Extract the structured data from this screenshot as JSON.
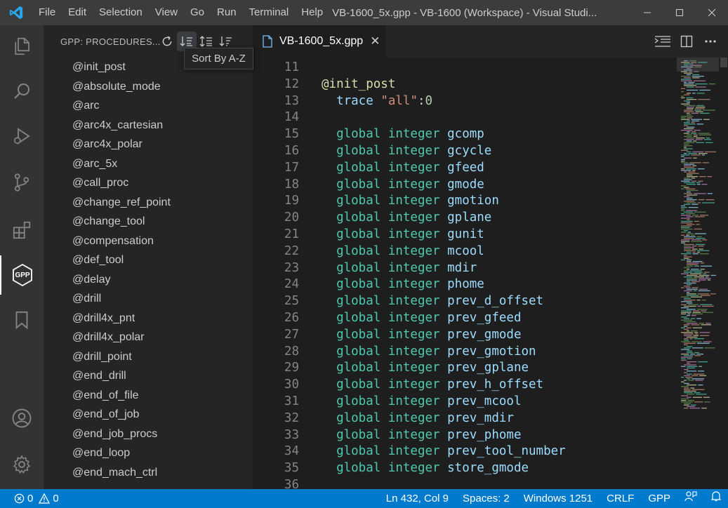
{
  "window": {
    "title": "VB-1600_5x.gpp - VB-1600 (Workspace) - Visual Studi...",
    "menu": [
      "File",
      "Edit",
      "Selection",
      "View",
      "Go",
      "Run",
      "Terminal",
      "Help"
    ]
  },
  "activity_bar": {
    "items": [
      "explorer-icon",
      "search-icon",
      "run-debug-icon",
      "source-control-icon",
      "extensions-icon",
      "gpp-icon",
      "bookmark-icon"
    ],
    "gpp_label": "GPP",
    "bottom": [
      "account-icon",
      "settings-gear-icon"
    ]
  },
  "sidebar": {
    "title": "GPP: PROCEDURES...",
    "actions": [
      "refresh-icon",
      "sort-az-icon",
      "sort-line-icon",
      "sort-desc-icon"
    ],
    "tooltip": "Sort By A-Z",
    "procedures": [
      "@init_post",
      "@absolute_mode",
      "@arc",
      "@arc4x_cartesian",
      "@arc4x_polar",
      "@arc_5x",
      "@call_proc",
      "@change_ref_point",
      "@change_tool",
      "@compensation",
      "@def_tool",
      "@delay",
      "@drill",
      "@drill4x_pnt",
      "@drill4x_polar",
      "@drill_point",
      "@end_drill",
      "@end_of_file",
      "@end_of_job",
      "@end_job_procs",
      "@end_loop",
      "@end_mach_ctrl"
    ]
  },
  "editor": {
    "tab": {
      "label": "VB-1600_5x.gpp",
      "icon": "file-icon"
    },
    "lines": [
      {
        "n": "11",
        "tokens": []
      },
      {
        "n": "12",
        "tokens": [
          [
            "@init_post",
            "at"
          ]
        ]
      },
      {
        "n": "13",
        "tokens": [
          [
            "  ",
            "plain"
          ],
          [
            "trace",
            "blue"
          ],
          [
            " ",
            "plain"
          ],
          [
            "\"all\"",
            "str"
          ],
          [
            ":",
            "plain"
          ],
          [
            "0",
            "num"
          ]
        ]
      },
      {
        "n": "14",
        "tokens": []
      },
      {
        "n": "15",
        "tokens": [
          [
            "  global integer ",
            "teal"
          ],
          [
            "gcomp",
            "blue"
          ]
        ]
      },
      {
        "n": "16",
        "tokens": [
          [
            "  global integer ",
            "teal"
          ],
          [
            "gcycle",
            "blue"
          ]
        ]
      },
      {
        "n": "17",
        "tokens": [
          [
            "  global integer ",
            "teal"
          ],
          [
            "gfeed",
            "blue"
          ]
        ]
      },
      {
        "n": "18",
        "tokens": [
          [
            "  global integer ",
            "teal"
          ],
          [
            "gmode",
            "blue"
          ]
        ]
      },
      {
        "n": "19",
        "tokens": [
          [
            "  global integer ",
            "teal"
          ],
          [
            "gmotion",
            "blue"
          ]
        ]
      },
      {
        "n": "20",
        "tokens": [
          [
            "  global integer ",
            "teal"
          ],
          [
            "gplane",
            "blue"
          ]
        ]
      },
      {
        "n": "21",
        "tokens": [
          [
            "  global integer ",
            "teal"
          ],
          [
            "gunit",
            "blue"
          ]
        ]
      },
      {
        "n": "22",
        "tokens": [
          [
            "  global integer ",
            "teal"
          ],
          [
            "mcool",
            "blue"
          ]
        ]
      },
      {
        "n": "23",
        "tokens": [
          [
            "  global integer ",
            "teal"
          ],
          [
            "mdir",
            "blue"
          ]
        ]
      },
      {
        "n": "24",
        "tokens": [
          [
            "  global integer ",
            "teal"
          ],
          [
            "phome",
            "blue"
          ]
        ]
      },
      {
        "n": "25",
        "tokens": [
          [
            "  global integer ",
            "teal"
          ],
          [
            "prev_d_offset",
            "blue"
          ]
        ]
      },
      {
        "n": "26",
        "tokens": [
          [
            "  global integer ",
            "teal"
          ],
          [
            "prev_gfeed",
            "blue"
          ]
        ]
      },
      {
        "n": "27",
        "tokens": [
          [
            "  global integer ",
            "teal"
          ],
          [
            "prev_gmode",
            "blue"
          ]
        ]
      },
      {
        "n": "28",
        "tokens": [
          [
            "  global integer ",
            "teal"
          ],
          [
            "prev_gmotion",
            "blue"
          ]
        ]
      },
      {
        "n": "29",
        "tokens": [
          [
            "  global integer ",
            "teal"
          ],
          [
            "prev_gplane",
            "blue"
          ]
        ]
      },
      {
        "n": "30",
        "tokens": [
          [
            "  global integer ",
            "teal"
          ],
          [
            "prev_h_offset",
            "blue"
          ]
        ]
      },
      {
        "n": "31",
        "tokens": [
          [
            "  global integer ",
            "teal"
          ],
          [
            "prev_mcool",
            "blue"
          ]
        ]
      },
      {
        "n": "32",
        "tokens": [
          [
            "  global integer ",
            "teal"
          ],
          [
            "prev_mdir",
            "blue"
          ]
        ]
      },
      {
        "n": "33",
        "tokens": [
          [
            "  global integer ",
            "teal"
          ],
          [
            "prev_phome",
            "blue"
          ]
        ]
      },
      {
        "n": "34",
        "tokens": [
          [
            "  global integer ",
            "teal"
          ],
          [
            "prev_tool_number",
            "blue"
          ]
        ]
      },
      {
        "n": "35",
        "tokens": [
          [
            "  global integer ",
            "teal"
          ],
          [
            "store_gmode",
            "blue"
          ]
        ]
      },
      {
        "n": "36",
        "tokens": []
      }
    ]
  },
  "status_bar": {
    "errors": "0",
    "warnings": "0",
    "position": "Ln 432, Col 9",
    "spaces": "Spaces: 2",
    "encoding": "Windows 1251",
    "eol": "CRLF",
    "language": "GPP"
  },
  "colors": {
    "accent": "#007acc",
    "keyword_teal": "#4ec9b0",
    "identifier_blue": "#9cdcfe",
    "procedure_yellow": "#dcdcaa",
    "string": "#ce9178"
  }
}
